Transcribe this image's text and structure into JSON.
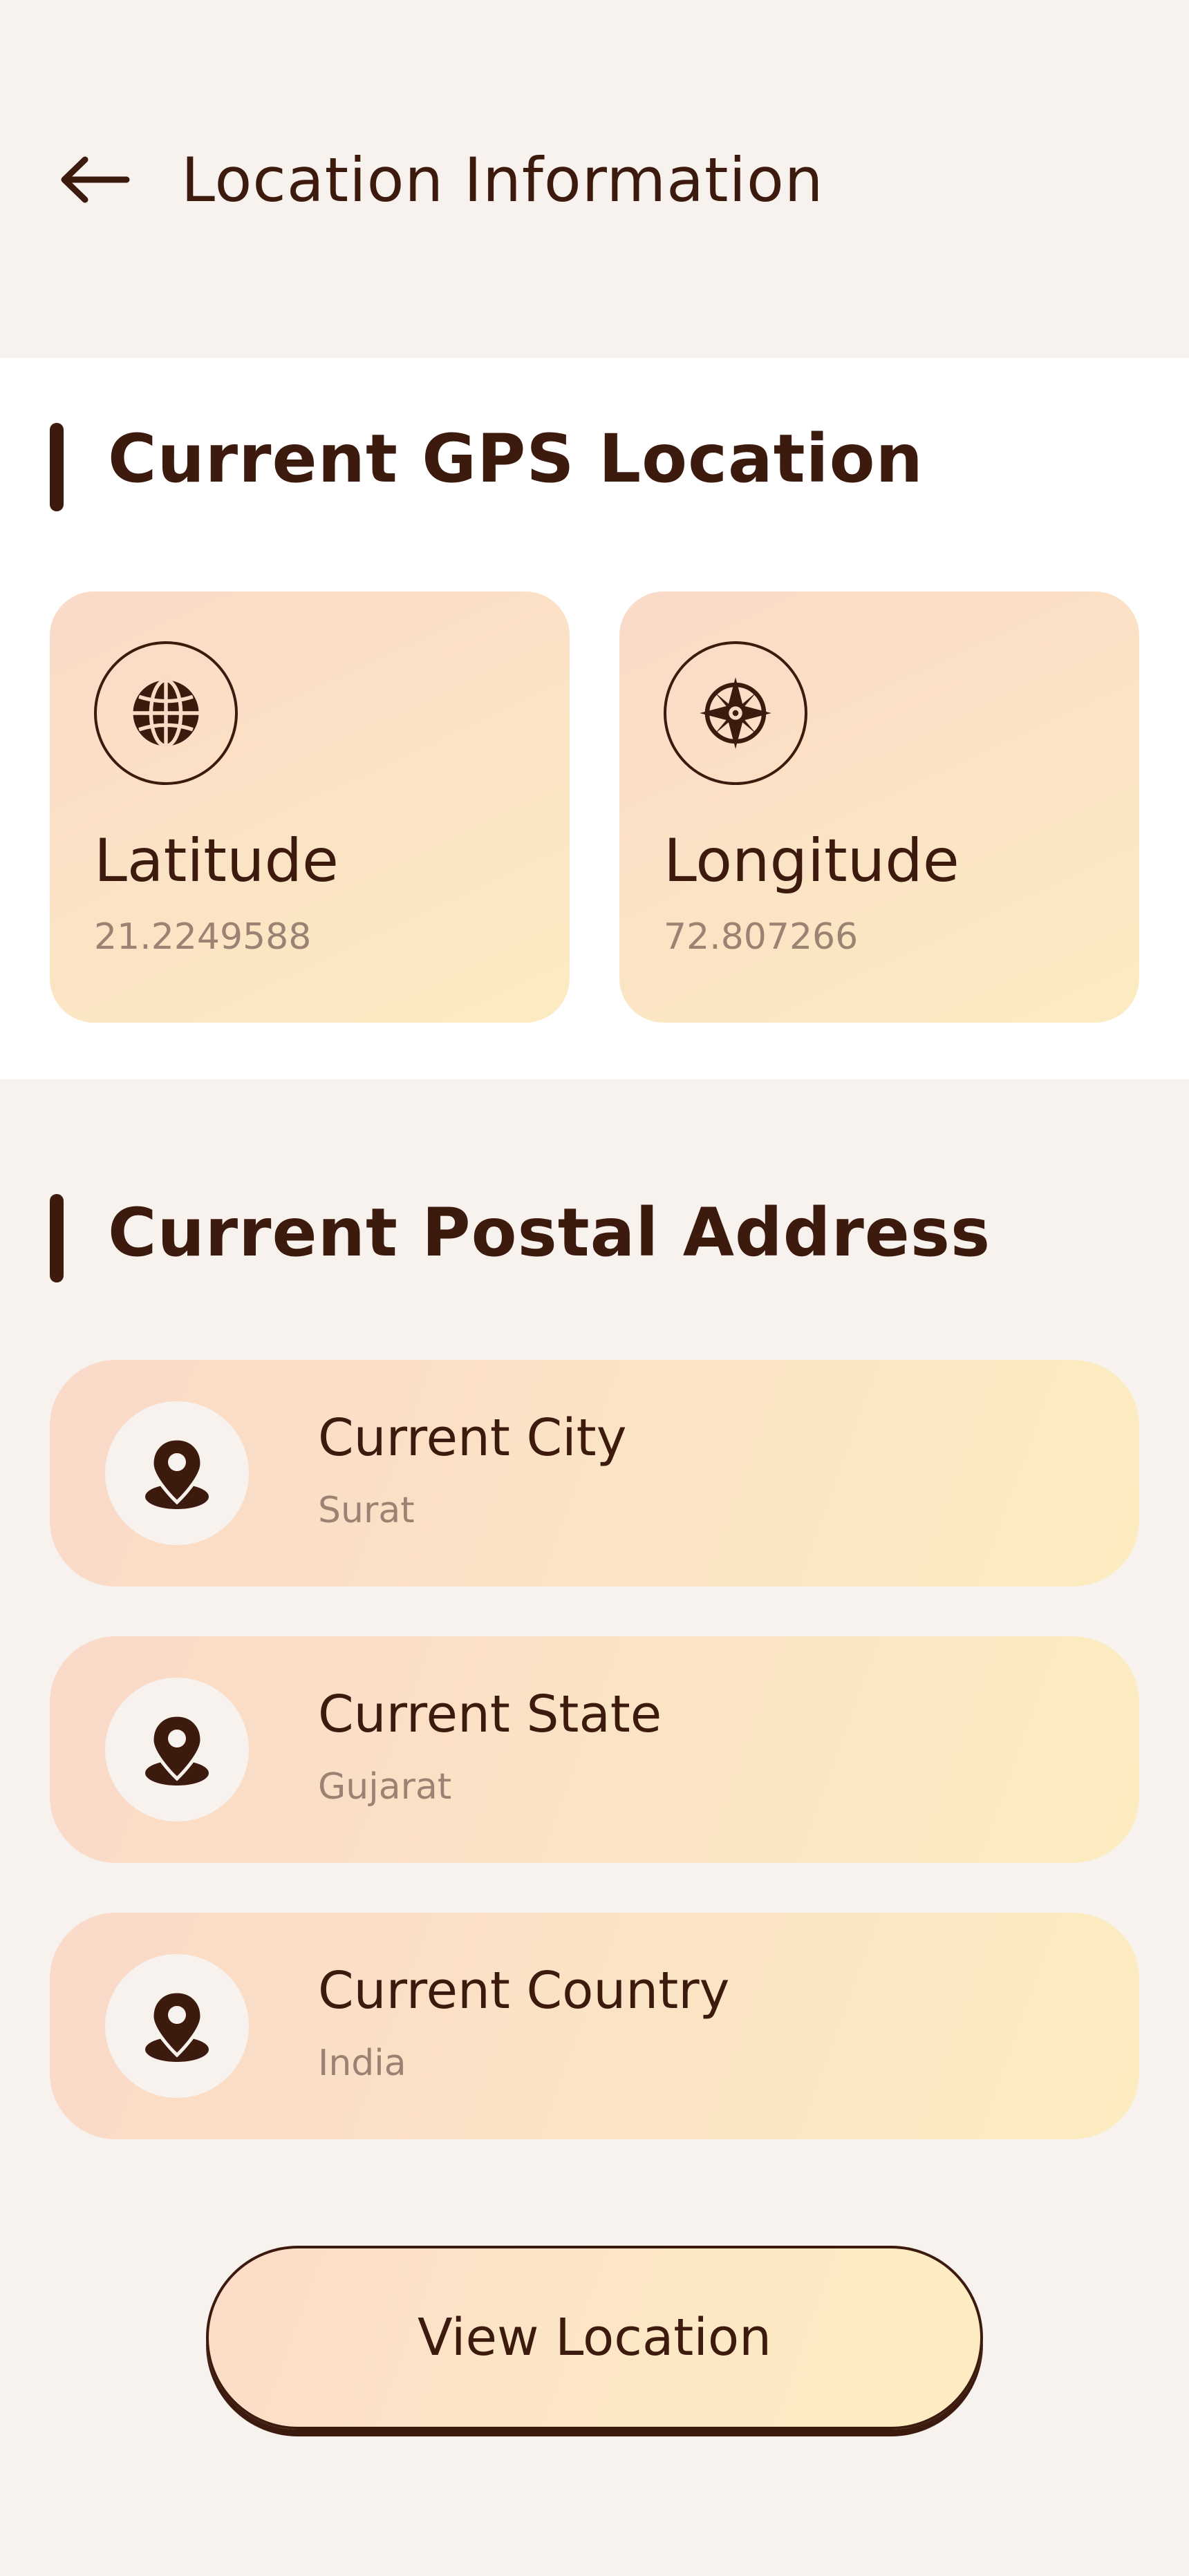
{
  "header": {
    "title": "Location Information",
    "back_icon": "arrow-left-icon"
  },
  "gps": {
    "heading": "Current GPS Location",
    "latitude": {
      "label": "Latitude",
      "value": "21.2249588",
      "icon": "globe-icon"
    },
    "longitude": {
      "label": "Longitude",
      "value": "72.807266",
      "icon": "compass-icon"
    }
  },
  "postal": {
    "heading": "Current Postal Address",
    "items": [
      {
        "label": "Current City",
        "value": "Surat",
        "icon": "map-pin-icon"
      },
      {
        "label": "Current State",
        "value": "Gujarat",
        "icon": "map-pin-icon"
      },
      {
        "label": "Current Country",
        "value": "India",
        "icon": "map-pin-icon"
      }
    ]
  },
  "actions": {
    "view_location_label": "View Location"
  },
  "colors": {
    "text_primary": "#3d1a0e",
    "text_secondary": "#9b8272",
    "background": "#f8f2ee",
    "card_gradient_start": "#fad9c8",
    "card_gradient_end": "#fcebc1"
  }
}
